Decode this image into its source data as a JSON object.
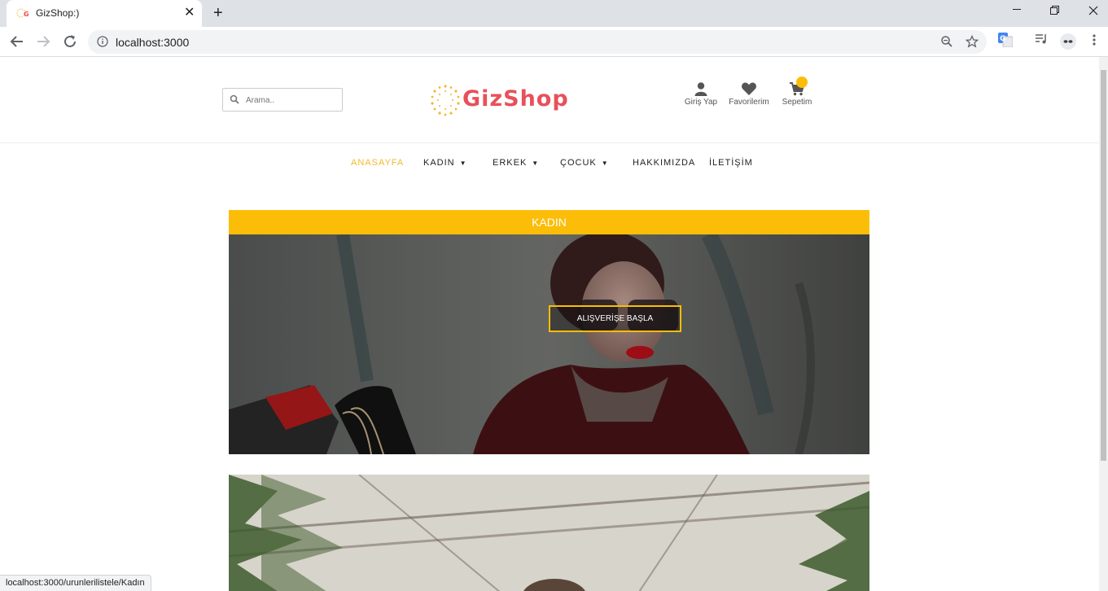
{
  "browser": {
    "tab_title": "GizShop:)",
    "url": "localhost:3000",
    "status_url": "localhost:3000/urunlerilistele/Kadın"
  },
  "header": {
    "search_placeholder": "Arama..",
    "logo_text": "GizShop",
    "links": {
      "login": "Giriş Yap",
      "favorites": "Favorilerim",
      "cart": "Sepetim"
    }
  },
  "nav": {
    "home": "ANASAYFA",
    "women": "KADIN",
    "men": "ERKEK",
    "kids": "ÇOCUK",
    "about": "HAKKIMIZDA",
    "contact": "İLETİŞİM"
  },
  "section": {
    "title": "KADIN",
    "cta": "ALIŞVERİŞE BAŞLA"
  },
  "colors": {
    "accent": "#fbbd08",
    "logo": "#e8505b",
    "active_nav": "#f4b82f"
  }
}
